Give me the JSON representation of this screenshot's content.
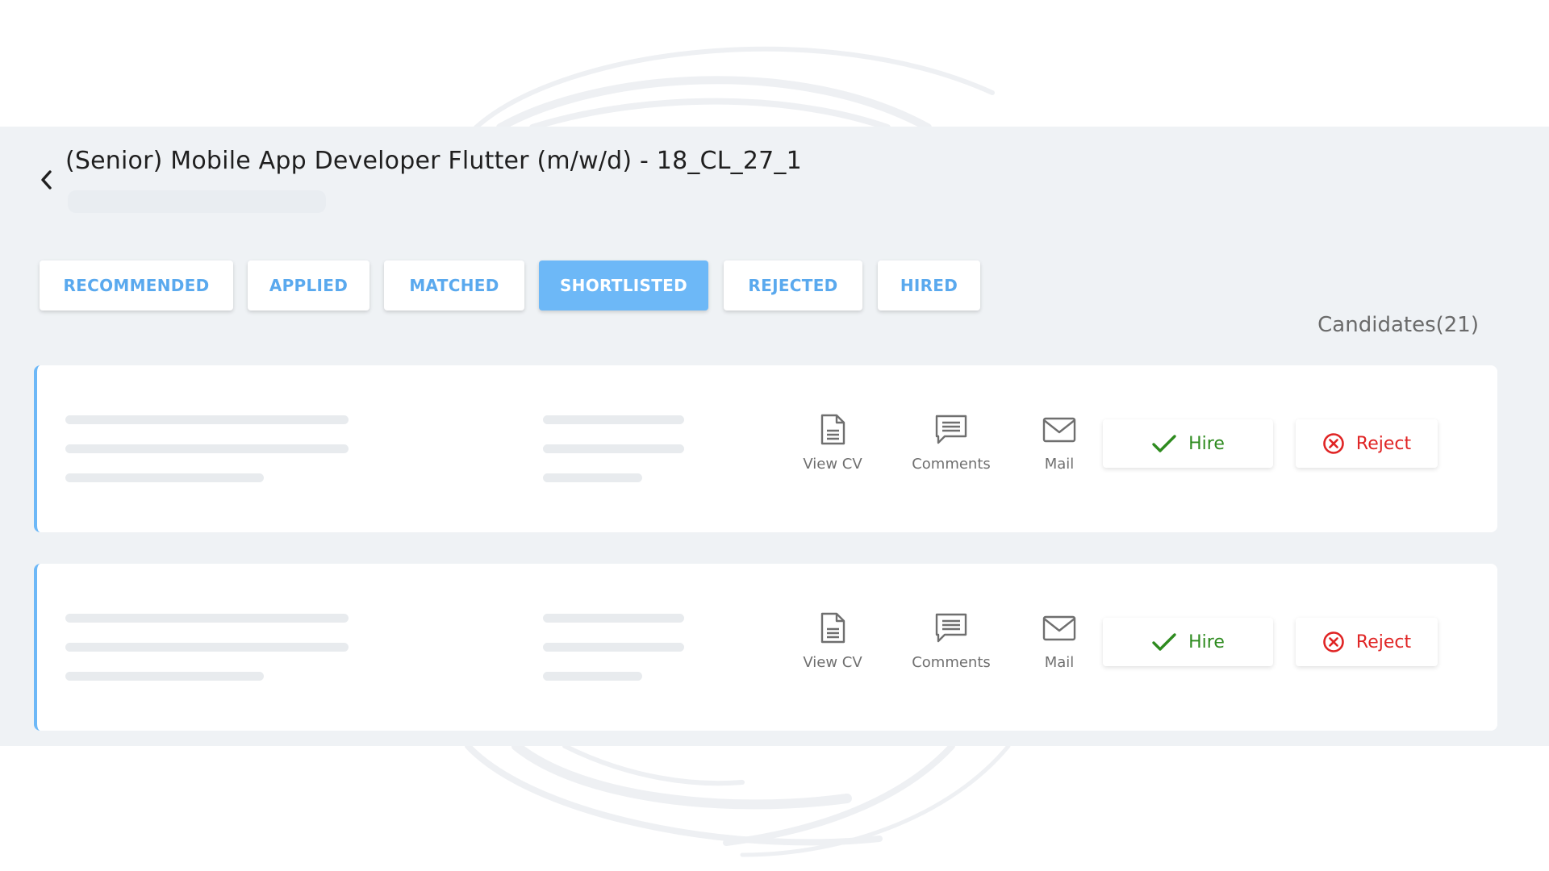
{
  "header": {
    "title": "(Senior) Mobile App Developer Flutter (m/w/d) - 18_CL_27_1"
  },
  "tabs": [
    {
      "label": "RECOMMENDED",
      "active": false
    },
    {
      "label": "APPLIED",
      "active": false
    },
    {
      "label": "MATCHED",
      "active": false
    },
    {
      "label": "SHORTLISTED",
      "active": true
    },
    {
      "label": "REJECTED",
      "active": false
    },
    {
      "label": "HIRED",
      "active": false
    }
  ],
  "candidates_label": "Candidates(21)",
  "cards": [
    {
      "actions": {
        "view_cv": "View CV",
        "comments": "Comments",
        "mail": "Mail"
      },
      "hire_label": "Hire",
      "reject_label": "Reject"
    },
    {
      "actions": {
        "view_cv": "View CV",
        "comments": "Comments",
        "mail": "Mail"
      },
      "hire_label": "Hire",
      "reject_label": "Reject"
    }
  ],
  "colors": {
    "accent": "#6db8f7",
    "tab_text": "#5aa9ee",
    "panel_bg": "#eff2f5",
    "hire": "#2e8b1f",
    "reject": "#e02424"
  },
  "icons": {
    "back": "chevron-left-icon",
    "view_cv": "document-icon",
    "comments": "comment-icon",
    "mail": "mail-icon",
    "hire": "check-icon",
    "reject": "circle-x-icon"
  }
}
